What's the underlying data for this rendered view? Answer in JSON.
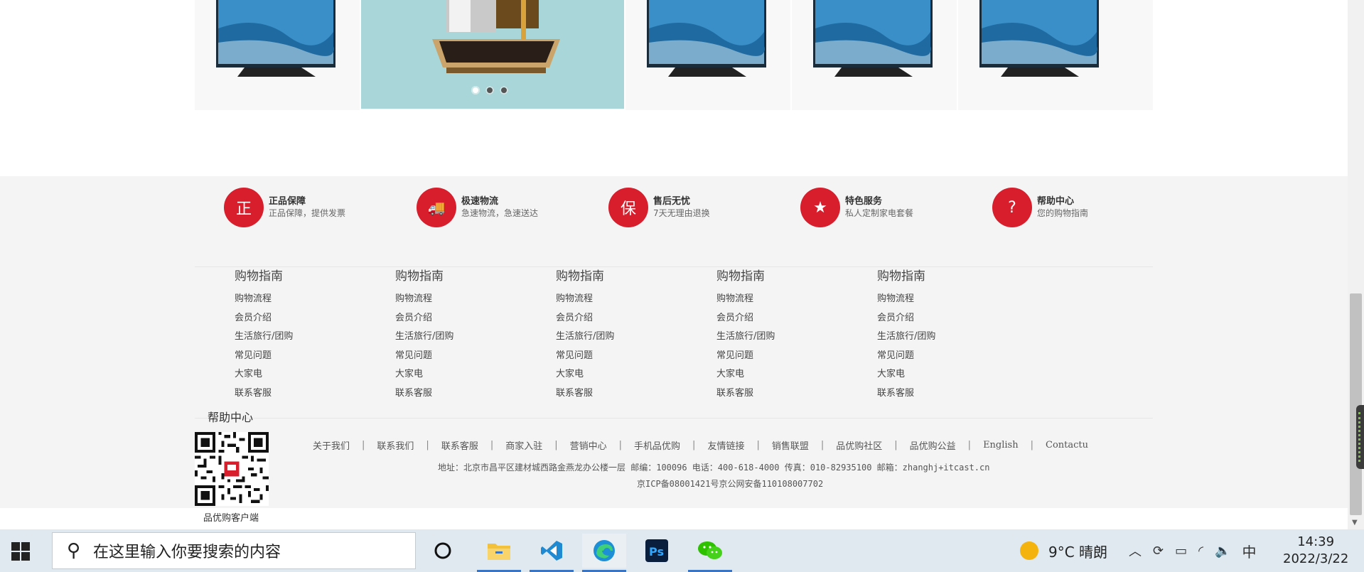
{
  "banner": {
    "dots": [
      true,
      false,
      false
    ]
  },
  "services": [
    {
      "icon": "authentic-icon",
      "glyph": "正",
      "title": "正品保障",
      "sub": "正品保障，提供发票"
    },
    {
      "icon": "delivery-truck-icon",
      "glyph": "🚚",
      "title": "极速物流",
      "sub": "急速物流，急速送达"
    },
    {
      "icon": "shield-icon",
      "glyph": "保",
      "title": "售后无忧",
      "sub": "7天无理由退换"
    },
    {
      "icon": "award-icon",
      "glyph": "★",
      "title": "特色服务",
      "sub": "私人定制家电套餐"
    },
    {
      "icon": "help-question-icon",
      "glyph": "?",
      "title": "帮助中心",
      "sub": "您的购物指南"
    }
  ],
  "guide_columns": [
    {
      "title": "购物指南",
      "links": [
        "购物流程",
        "会员介绍",
        "生活旅行/团购",
        "常见问题",
        "大家电",
        "联系客服"
      ]
    },
    {
      "title": "购物指南",
      "links": [
        "购物流程",
        "会员介绍",
        "生活旅行/团购",
        "常见问题",
        "大家电",
        "联系客服"
      ]
    },
    {
      "title": "购物指南",
      "links": [
        "购物流程",
        "会员介绍",
        "生活旅行/团购",
        "常见问题",
        "大家电",
        "联系客服"
      ]
    },
    {
      "title": "购物指南",
      "links": [
        "购物流程",
        "会员介绍",
        "生活旅行/团购",
        "常见问题",
        "大家电",
        "联系客服"
      ]
    },
    {
      "title": "购物指南",
      "links": [
        "购物流程",
        "会员介绍",
        "生活旅行/团购",
        "常见问题",
        "大家电",
        "联系客服"
      ]
    }
  ],
  "help": {
    "title": "帮助中心",
    "qr_label": "品优购客户端"
  },
  "footer_links": [
    "关于我们",
    "联系我们",
    "联系客服",
    "商家入驻",
    "营销中心",
    "手机品优购",
    "友情链接",
    "销售联盟",
    "品优购社区",
    "品优购公益",
    "English",
    "Contactu"
  ],
  "footer_separator": "|",
  "address": "地址：北京市昌平区建材城西路金燕龙办公楼一层 邮编：100096 电话：400-618-4000 传真：010-82935100 邮箱：zhanghj+itcast.cn",
  "icp": "京ICP备08001421号京公网安备110108007702",
  "taskbar": {
    "search_placeholder": "在这里输入你要搜索的内容",
    "weather": "9°C  晴朗",
    "ime": "中",
    "time": "14:39",
    "date": "2022/3/22",
    "apps": [
      "cortana-icon",
      "file-explorer-icon",
      "vscode-icon",
      "edge-icon",
      "photoshop-icon",
      "wechat-icon"
    ]
  },
  "colors": {
    "accent_red": "#d81e2c",
    "banner_bg": "#a9d6d8",
    "footer_bg": "#f4f4f4"
  }
}
